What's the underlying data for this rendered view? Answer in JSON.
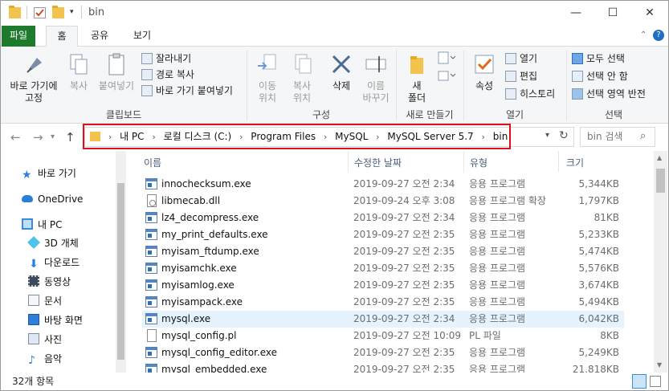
{
  "window": {
    "title": "bin",
    "minimize": "—",
    "maximize": "☐",
    "close": "✕"
  },
  "ribbon_tabs": [
    "파일",
    "홈",
    "공유",
    "보기"
  ],
  "ribbon": {
    "clipboard": {
      "pin_label_1": "바로 가기에",
      "pin_label_2": "고정",
      "copy_label": "복사",
      "paste_label": "붙여넣기",
      "cut_label": "잘라내기",
      "copy_path_label": "경로 복사",
      "paste_shortcut_label": "바로 가기 붙여넣기",
      "group_label": "클립보드"
    },
    "organize": {
      "move_label_1": "이동",
      "move_label_2": "위치",
      "copyto_label_1": "복사",
      "copyto_label_2": "위치",
      "delete_label": "삭제",
      "rename_label_1": "이름",
      "rename_label_2": "바꾸기",
      "group_label": "구성"
    },
    "new": {
      "new_folder_label_1": "새",
      "new_folder_label_2": "폴더",
      "group_label": "새로 만들기"
    },
    "open": {
      "properties_label": "속성",
      "open_label": "열기",
      "edit_label": "편집",
      "history_label": "히스토리",
      "group_label": "열기"
    },
    "select": {
      "select_all_label": "모두 선택",
      "select_none_label": "선택 안 함",
      "invert_label": "선택 영역 반전",
      "group_label": "선택"
    }
  },
  "address": {
    "crumbs": [
      "내 PC",
      "로컬 디스크 (C:)",
      "Program Files",
      "MySQL",
      "MySQL Server 5.7",
      "bin"
    ],
    "search_placeholder": "bin 검색"
  },
  "nav": {
    "items": [
      {
        "label": "바로 가기",
        "icon": "star-icon"
      },
      {
        "label": "OneDrive",
        "icon": "cloud-icon"
      },
      {
        "label": "내 PC",
        "icon": "computer-icon"
      },
      {
        "label": "3D 개체",
        "icon": "cube-icon"
      },
      {
        "label": "다운로드",
        "icon": "download-icon"
      },
      {
        "label": "동영상",
        "icon": "video-icon"
      },
      {
        "label": "문서",
        "icon": "document-icon"
      },
      {
        "label": "바탕 화면",
        "icon": "desktop-icon"
      },
      {
        "label": "사진",
        "icon": "picture-icon"
      },
      {
        "label": "음악",
        "icon": "music-icon"
      }
    ]
  },
  "columns": {
    "name": "이름",
    "date": "수정한 날짜",
    "type": "유형",
    "size": "크기"
  },
  "files": [
    {
      "name": "innochecksum.exe",
      "date": "2019-09-27 오전 2:34",
      "type": "응용 프로그램",
      "size": "5,344KB",
      "icon": "exe"
    },
    {
      "name": "libmecab.dll",
      "date": "2019-09-24 오후 3:08",
      "type": "응용 프로그램 확장",
      "size": "1,797KB",
      "icon": "dll"
    },
    {
      "name": "lz4_decompress.exe",
      "date": "2019-09-27 오전 2:34",
      "type": "응용 프로그램",
      "size": "81KB",
      "icon": "exe"
    },
    {
      "name": "my_print_defaults.exe",
      "date": "2019-09-27 오전 2:35",
      "type": "응용 프로그램",
      "size": "5,233KB",
      "icon": "exe"
    },
    {
      "name": "myisam_ftdump.exe",
      "date": "2019-09-27 오전 2:35",
      "type": "응용 프로그램",
      "size": "5,474KB",
      "icon": "exe"
    },
    {
      "name": "myisamchk.exe",
      "date": "2019-09-27 오전 2:35",
      "type": "응용 프로그램",
      "size": "5,576KB",
      "icon": "exe"
    },
    {
      "name": "myisamlog.exe",
      "date": "2019-09-27 오전 2:35",
      "type": "응용 프로그램",
      "size": "3,674KB",
      "icon": "exe"
    },
    {
      "name": "myisampack.exe",
      "date": "2019-09-27 오전 2:35",
      "type": "응용 프로그램",
      "size": "5,494KB",
      "icon": "exe"
    },
    {
      "name": "mysql.exe",
      "date": "2019-09-27 오전 2:34",
      "type": "응용 프로그램",
      "size": "6,042KB",
      "icon": "exe",
      "selected": true
    },
    {
      "name": "mysql_config.pl",
      "date": "2019-09-27 오전 10:09",
      "type": "PL 파일",
      "size": "8KB",
      "icon": "doc"
    },
    {
      "name": "mysql_config_editor.exe",
      "date": "2019-09-27 오전 2:35",
      "type": "응용 프로그램",
      "size": "5,249KB",
      "icon": "exe"
    },
    {
      "name": "mysql_embedded.exe",
      "date": "2019-09-27 오전 2:35",
      "type": "응용 프로그램",
      "size": "21,818KB",
      "icon": "exe"
    }
  ],
  "status": {
    "item_count": "32개 항목"
  },
  "colors": {
    "accent_file_tab": "#1e7b2e",
    "highlight_box": "#e0101a",
    "selection": "#e5f3ff"
  }
}
